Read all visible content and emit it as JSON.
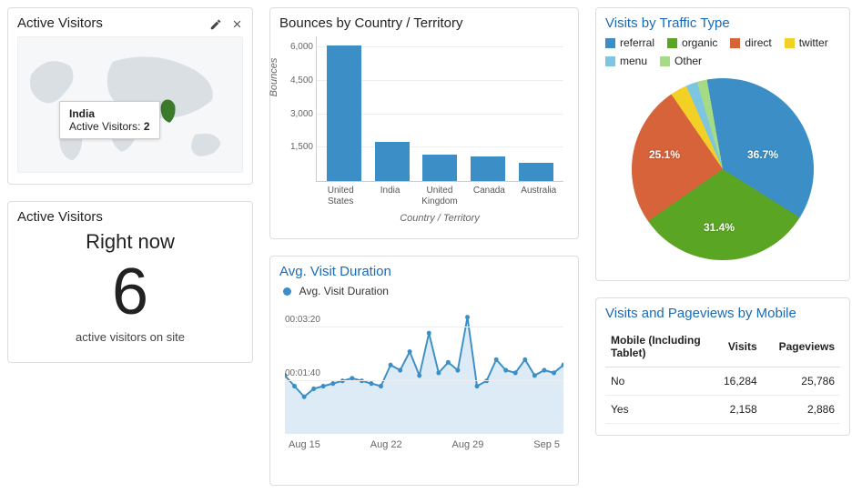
{
  "colors": {
    "blue": "#3b8fc6",
    "green": "#5aa524",
    "orange": "#d6633a",
    "yellow": "#f2d026",
    "lightblue": "#7ec6e0",
    "lightgreen": "#a6db86"
  },
  "activeVisitorsMap": {
    "title": "Active Visitors",
    "tooltip_country": "India",
    "tooltip_label": "Active Visitors:",
    "tooltip_value": "2"
  },
  "activeVisitorsNow": {
    "title": "Active Visitors",
    "header": "Right now",
    "value": "6",
    "sub": "active visitors on site"
  },
  "bounces": {
    "title": "Bounces by Country / Territory",
    "xlabel": "Country / Territory",
    "ylabel": "Bounces"
  },
  "avgDuration": {
    "title": "Avg. Visit Duration",
    "legend": "Avg. Visit Duration"
  },
  "traffic": {
    "title": "Visits by Traffic Type",
    "legend": [
      "referral",
      "organic",
      "direct",
      "twitter",
      "menu",
      "Other"
    ],
    "slice_labels": {
      "referral": "36.7%",
      "organic": "31.4%",
      "direct": "25.1%"
    }
  },
  "mobile": {
    "title": "Visits and Pageviews by Mobile",
    "header": [
      "Mobile (Including Tablet)",
      "Visits",
      "Pageviews"
    ],
    "rows": [
      [
        "No",
        "16,284",
        "25,786"
      ],
      [
        "Yes",
        "2,158",
        "2,886"
      ]
    ]
  },
  "chart_data": [
    {
      "type": "bar",
      "title": "Bounces by Country / Territory",
      "xlabel": "Country / Territory",
      "ylabel": "Bounces",
      "categories": [
        "United States",
        "India",
        "United Kingdom",
        "Canada",
        "Australia"
      ],
      "values": [
        6100,
        1750,
        1200,
        1100,
        800
      ],
      "ylim": [
        0,
        6500
      ],
      "yticks": [
        1500,
        3000,
        4500,
        6000
      ]
    },
    {
      "type": "line",
      "title": "Avg. Visit Duration",
      "series_name": "Avg. Visit Duration",
      "x_ticks": [
        "Aug 15",
        "Aug 22",
        "Aug 29",
        "Sep 5"
      ],
      "y_ticks_sec": [
        100,
        200
      ],
      "y_tick_labels": [
        "00:01:40",
        "00:03:20"
      ],
      "values_seconds": [
        110,
        90,
        70,
        85,
        90,
        95,
        100,
        105,
        100,
        95,
        90,
        130,
        120,
        155,
        110,
        190,
        115,
        135,
        120,
        220,
        90,
        100,
        140,
        120,
        115,
        140,
        110,
        120,
        115,
        130
      ],
      "ylim_sec": [
        0,
        240
      ]
    },
    {
      "type": "pie",
      "title": "Visits by Traffic Type",
      "series": [
        {
          "name": "referral",
          "value": 36.7,
          "color": "#3b8fc6"
        },
        {
          "name": "organic",
          "value": 31.4,
          "color": "#5aa524"
        },
        {
          "name": "direct",
          "value": 25.1,
          "color": "#d6633a"
        },
        {
          "name": "twitter",
          "value": 3.0,
          "color": "#f2d026"
        },
        {
          "name": "menu",
          "value": 2.0,
          "color": "#7ec6e0"
        },
        {
          "name": "Other",
          "value": 1.8,
          "color": "#a6db86"
        }
      ]
    },
    {
      "type": "table",
      "title": "Visits and Pageviews by Mobile",
      "columns": [
        "Mobile (Including Tablet)",
        "Visits",
        "Pageviews"
      ],
      "rows": [
        [
          "No",
          16284,
          25786
        ],
        [
          "Yes",
          2158,
          2886
        ]
      ]
    }
  ]
}
